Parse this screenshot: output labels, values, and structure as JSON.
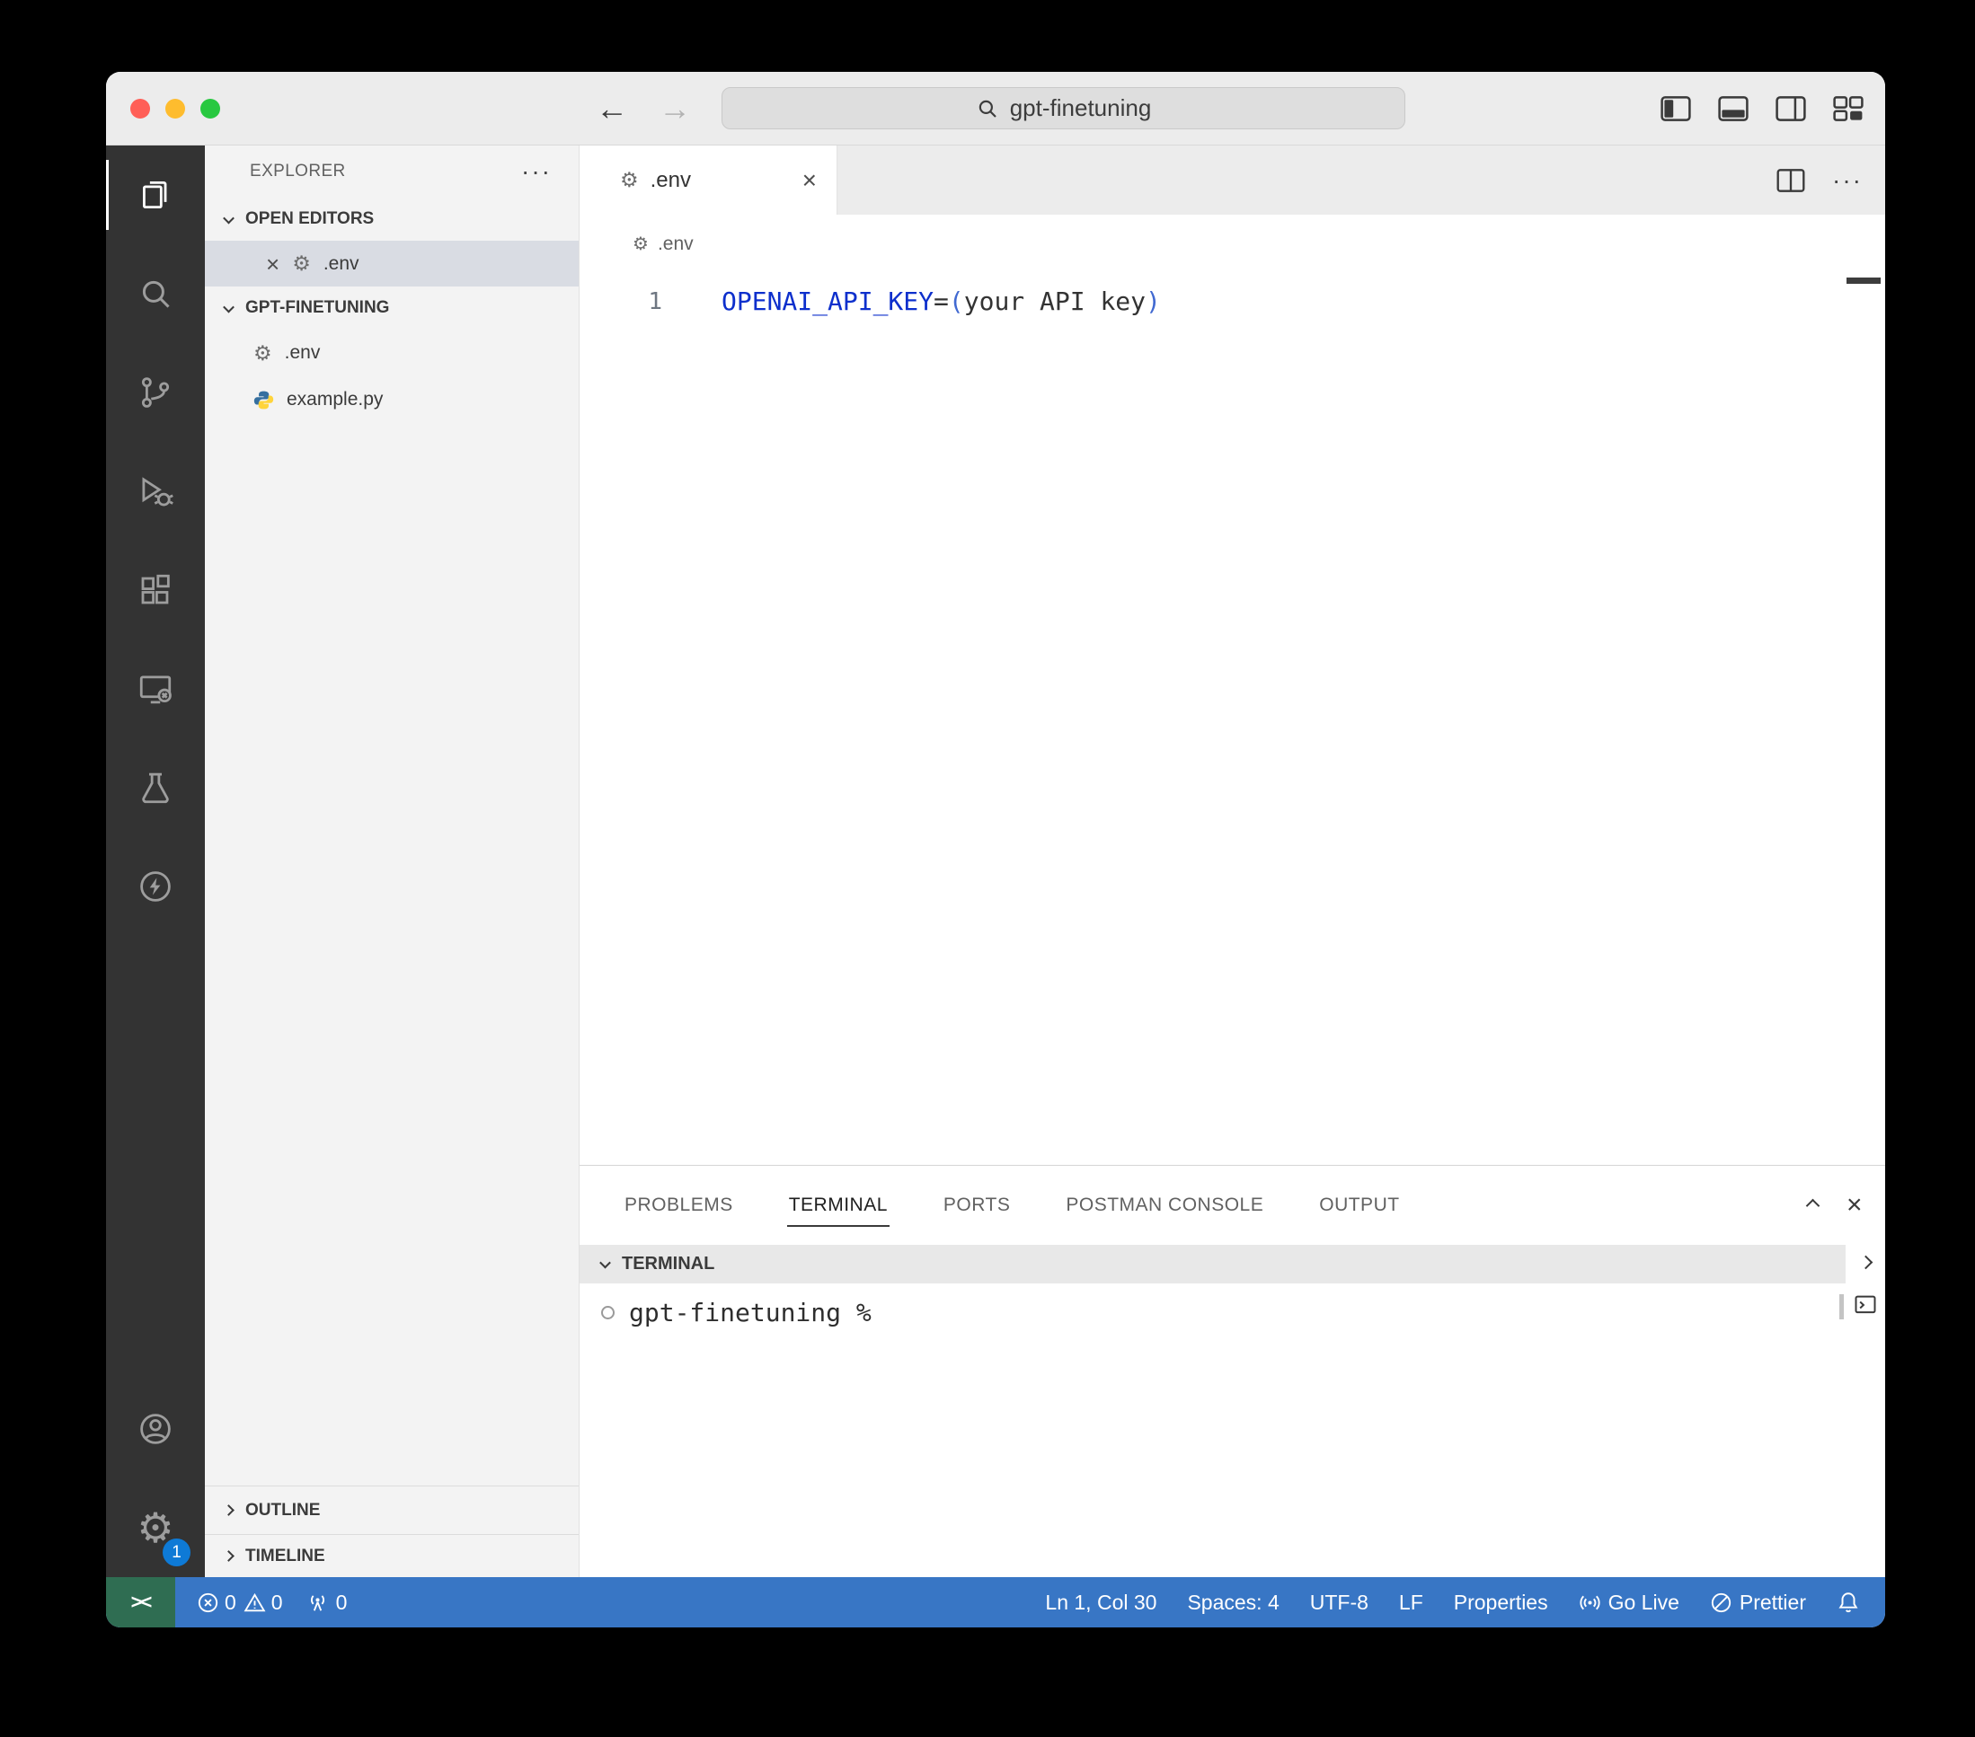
{
  "colors": {
    "status-bar-bg": "#3876c5",
    "remote-indicator-bg": "#2f6d52",
    "badge-bg": "#0e7ad6",
    "code-key": "#0d2fcc",
    "code-paren": "#4169d1",
    "code-value": "#333333",
    "python-blue": "#356f9f",
    "python-yellow": "#ffd43b"
  },
  "ui": {
    "more": "···"
  },
  "titlebar": {
    "search": "gpt-finetuning"
  },
  "activity_bar": {
    "settings_badge": "1"
  },
  "sidebar": {
    "title": "EXPLORER",
    "open_editors": {
      "label": "OPEN EDITORS",
      "items": [
        {
          "name": ".env"
        }
      ]
    },
    "workspace": {
      "label": "GPT-FINETUNING",
      "files": [
        {
          "name": ".env"
        },
        {
          "name": "example.py"
        }
      ]
    },
    "outline_label": "OUTLINE",
    "timeline_label": "TIMELINE"
  },
  "editor": {
    "tab": ".env",
    "breadcrumb": ".env",
    "line_number": "1",
    "code": {
      "key": "OPENAI_API_KEY",
      "operator": "=",
      "open_paren": "(",
      "value": "your API key",
      "close_paren": ")"
    }
  },
  "panel": {
    "tabs": [
      "PROBLEMS",
      "TERMINAL",
      "PORTS",
      "POSTMAN CONSOLE",
      "OUTPUT"
    ],
    "active_tab": "TERMINAL",
    "terminal": {
      "section_label": "TERMINAL",
      "prompt": "gpt-finetuning %"
    }
  },
  "status_bar": {
    "remote_glyph": "><",
    "errors": "0",
    "warnings": "0",
    "ports": "0",
    "cursor": "Ln 1, Col 30",
    "indent": "Spaces: 4",
    "encoding": "UTF-8",
    "eol": "LF",
    "language": "Properties",
    "go_live": "Go Live",
    "formatter": "Prettier"
  }
}
